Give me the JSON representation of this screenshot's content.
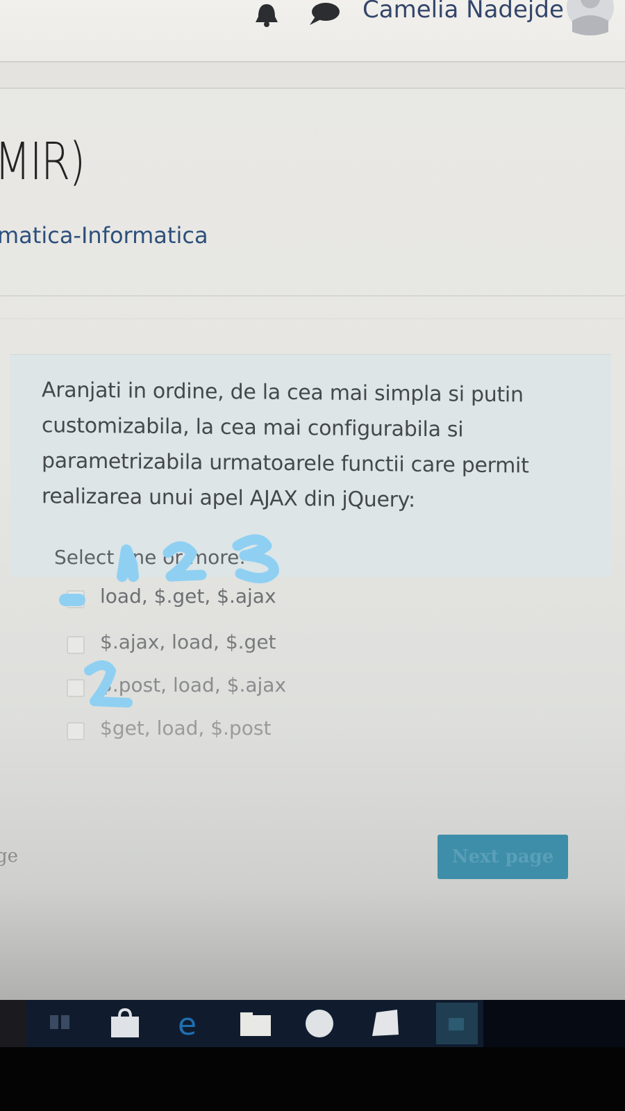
{
  "header": {
    "user_name": "Camelia Nadejde",
    "icons": [
      "bell-icon",
      "chat-icon",
      "avatar-icon"
    ]
  },
  "page": {
    "title_fragment": "MIR)",
    "breadcrumb_fragment": "matica-Informatica"
  },
  "question": {
    "text": "Aranjati in ordine, de la cea mai simpla si putin customizabila, la cea mai configurabila si parametrizabila urmatoarele functii care permit realizarea unui apel AJAX din jQuery:",
    "instruction": "Select one or more:",
    "options": [
      {
        "label": "load, $.get, $.ajax",
        "checked": false
      },
      {
        "label": "$.ajax, load, $.get",
        "checked": false
      },
      {
        "label": "$.post, load, $.ajax",
        "checked": false
      },
      {
        "label": "$get, load, $.post",
        "checked": false
      }
    ]
  },
  "navigation": {
    "next_label": "Next page",
    "prev_fragment": "ge"
  },
  "colors": {
    "accent": "#3e8ea9",
    "user_name": "#33456a",
    "breadcrumb_link": "#2c4f7c",
    "handwritten_marks": "#8fd0f2"
  }
}
